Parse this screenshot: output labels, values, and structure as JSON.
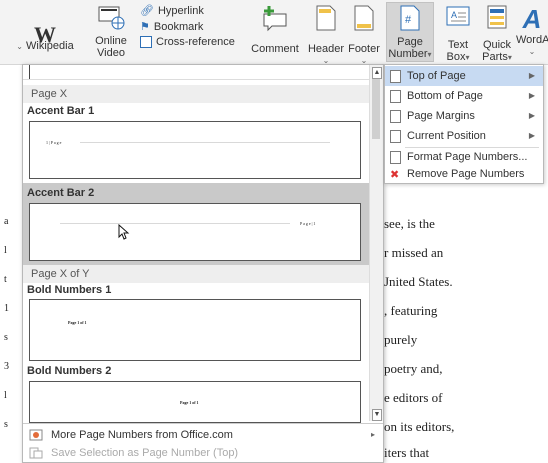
{
  "ribbon": {
    "wikipedia": "Wikipedia",
    "online_video": [
      "Online",
      "Video"
    ],
    "hyperlink": "Hyperlink",
    "bookmark": "Bookmark",
    "cross_reference": "Cross-reference",
    "comment": "Comment",
    "header": "Header",
    "footer": "Footer",
    "page_number": [
      "Page",
      "Number"
    ],
    "text_box": [
      "Text",
      "Box"
    ],
    "quick_parts": [
      "Quick",
      "Parts"
    ],
    "wordart": "WordA"
  },
  "gallery": {
    "section1_head": "Page X",
    "item1": {
      "title": "Accent Bar 1",
      "page_text": "1 | P a g e"
    },
    "item2": {
      "title": "Accent Bar 2",
      "page_text": "P a g e  | 1"
    },
    "section2_head": "Page X of Y",
    "item3": {
      "title": "Bold Numbers 1",
      "page_text": "Page 1 of 1"
    },
    "item4": {
      "title": "Bold Numbers 2",
      "page_text": "Page 1 of 1"
    },
    "footer": {
      "more": "More Page Numbers from Office.com",
      "save": "Save Selection as Page Number (Top)"
    }
  },
  "menu": {
    "items": [
      {
        "label": "Top of Page",
        "submenu": true,
        "active": true
      },
      {
        "label": "Bottom of Page",
        "submenu": true
      },
      {
        "label": "Page Margins",
        "submenu": true
      },
      {
        "label": "Current Position",
        "submenu": true
      },
      {
        "label": "Format Page Numbers...",
        "submenu": false
      },
      {
        "label": "Remove Page Numbers",
        "submenu": false
      }
    ]
  },
  "document": {
    "lines": [
      "see, is the",
      "r missed an",
      "Jnited States.",
      ", featuring",
      "purely",
      "poetry and,",
      "e editors of",
      "on its editors,",
      "iters that"
    ],
    "left_chars": [
      "a",
      "l",
      "t",
      "1",
      "s",
      "3",
      "l",
      "s"
    ]
  }
}
